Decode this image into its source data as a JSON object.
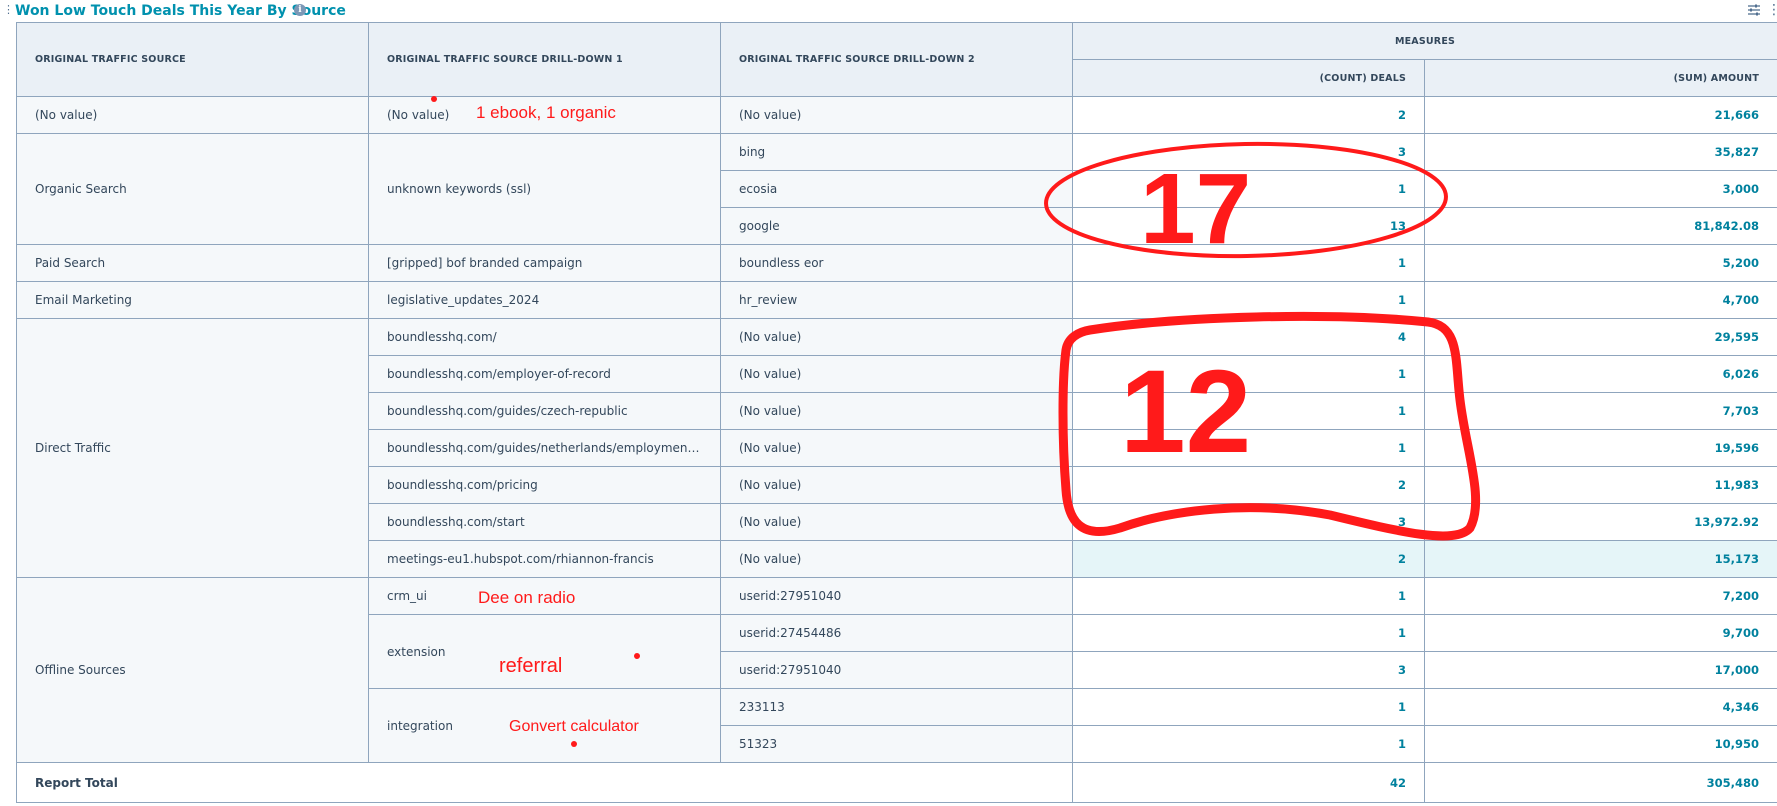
{
  "header": {
    "title": "Won Low Touch Deals This Year By Source",
    "info_icon": "info-icon",
    "settings_icon": "sliders-icon",
    "more_icon": "vertical-dots-icon"
  },
  "table": {
    "columns": {
      "source": "ORIGINAL TRAFFIC SOURCE",
      "drill1": "ORIGINAL TRAFFIC SOURCE DRILL-DOWN 1",
      "drill2": "ORIGINAL TRAFFIC SOURCE DRILL-DOWN 2",
      "measures": "MEASURES",
      "deals": "(COUNT) DEALS",
      "amount": "(SUM) AMOUNT"
    },
    "groups": {
      "no_value": {
        "source": "(No value)",
        "drill1": "(No value)",
        "rows": [
          {
            "drill2": "(No value)",
            "deals": "2",
            "amount": "21,666"
          }
        ]
      },
      "organic": {
        "source": "Organic Search",
        "drill1": "unknown keywords (ssl)",
        "rows": [
          {
            "drill2": "bing",
            "deals": "3",
            "amount": "35,827"
          },
          {
            "drill2": "ecosia",
            "deals": "1",
            "amount": "3,000"
          },
          {
            "drill2": "google",
            "deals": "13",
            "amount": "81,842.08"
          }
        ]
      },
      "paid": {
        "source": "Paid Search",
        "drill1": "[gripped] bof branded campaign",
        "rows": [
          {
            "drill2": "boundless eor",
            "deals": "1",
            "amount": "5,200"
          }
        ]
      },
      "email": {
        "source": "Email Marketing",
        "drill1": "legislative_updates_2024",
        "rows": [
          {
            "drill2": "hr_review",
            "deals": "1",
            "amount": "4,700"
          }
        ]
      },
      "direct": {
        "source": "Direct Traffic",
        "rows": [
          {
            "drill1": "boundlesshq.com/",
            "drill2": "(No value)",
            "deals": "4",
            "amount": "29,595"
          },
          {
            "drill1": "boundlesshq.com/employer-of-record",
            "drill2": "(No value)",
            "deals": "1",
            "amount": "6,026"
          },
          {
            "drill1": "boundlesshq.com/guides/czech-republic",
            "drill2": "(No value)",
            "deals": "1",
            "amount": "7,703"
          },
          {
            "drill1": "boundlesshq.com/guides/netherlands/employment-cost-...",
            "drill2": "(No value)",
            "deals": "1",
            "amount": "19,596"
          },
          {
            "drill1": "boundlesshq.com/pricing",
            "drill2": "(No value)",
            "deals": "2",
            "amount": "11,983"
          },
          {
            "drill1": "boundlesshq.com/start",
            "drill2": "(No value)",
            "deals": "3",
            "amount": "13,972.92"
          },
          {
            "drill1": "meetings-eu1.hubspot.com/rhiannon-francis",
            "drill2": "(No value)",
            "deals": "2",
            "amount": "15,173"
          }
        ]
      },
      "offline": {
        "source": "Offline Sources",
        "crm_ui": {
          "drill1": "crm_ui",
          "rows": [
            {
              "drill2": "userid:27951040",
              "deals": "1",
              "amount": "7,200"
            }
          ]
        },
        "extension": {
          "drill1": "extension",
          "rows": [
            {
              "drill2": "userid:27454486",
              "deals": "1",
              "amount": "9,700"
            },
            {
              "drill2": "userid:27951040",
              "deals": "3",
              "amount": "17,000"
            }
          ]
        },
        "integration": {
          "drill1": "integration",
          "rows": [
            {
              "drill2": "233113",
              "deals": "1",
              "amount": "4,346"
            },
            {
              "drill2": "51323",
              "deals": "1",
              "amount": "10,950"
            }
          ]
        }
      }
    },
    "total": {
      "label": "Report Total",
      "deals": "42",
      "amount": "305,480"
    }
  },
  "annotations": {
    "note_no_value": "1 ebook, 1 organic",
    "note_crm_ui": "Dee on radio",
    "note_extension": "referral",
    "note_integration": "Gonvert calculator",
    "circled_organic": "17",
    "circled_direct": "12",
    "ink_color": "#ff1a1a"
  },
  "colors": {
    "accent": "#0091ae",
    "number": "#00819e",
    "header_bg": "#eaf0f6",
    "border": "#8fa5bd",
    "highlight_row": "#e5f5f8"
  }
}
